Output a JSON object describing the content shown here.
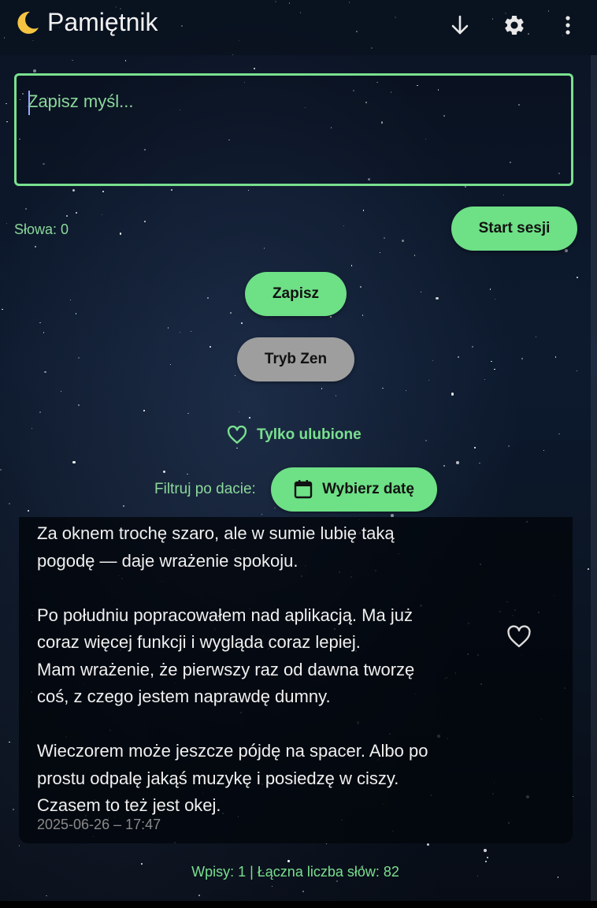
{
  "app": {
    "title": "Pamiętnik"
  },
  "toolbar": {
    "icons": [
      "download-arrow-icon",
      "gear-icon",
      "more-vert-icon"
    ]
  },
  "editor": {
    "placeholder": "Zapisz myśl..."
  },
  "word_counter": "Słowa: 0",
  "buttons": {
    "start_session": "Start sesji",
    "save": "Zapisz",
    "zen_mode": "Tryb Zen",
    "pick_date": "Wybierz datę"
  },
  "filters": {
    "favorites_only": "Tylko ulubione",
    "date_label": "Filtruj po dacie:"
  },
  "entries": [
    {
      "text": "Za oknem trochę szaro, ale w sumie lubię taką\npogodę — daje wrażenie spokoju.\n\nPo południu popracowałem nad aplikacją. Ma już\ncoraz więcej funkcji i wygląda coraz lepiej.\nMam wrażenie, że pierwszy raz od dawna tworzę\ncoś, z czego jestem naprawdę dumny.\n\nWieczorem może jeszcze pójdę na spacer. Albo po\nprostu odpalę jakąś muzykę i posiedzę w ciszy.\nCzasem to też jest okej.",
      "date": "2025-06-26 – 17:47",
      "favorite": false
    }
  ],
  "stats": "Wpisy: 1 | Łączna liczba słów: 82",
  "colors": {
    "accent": "#6ee086",
    "accent_text": "#79e08f",
    "button_grey": "#9e9e9e"
  }
}
